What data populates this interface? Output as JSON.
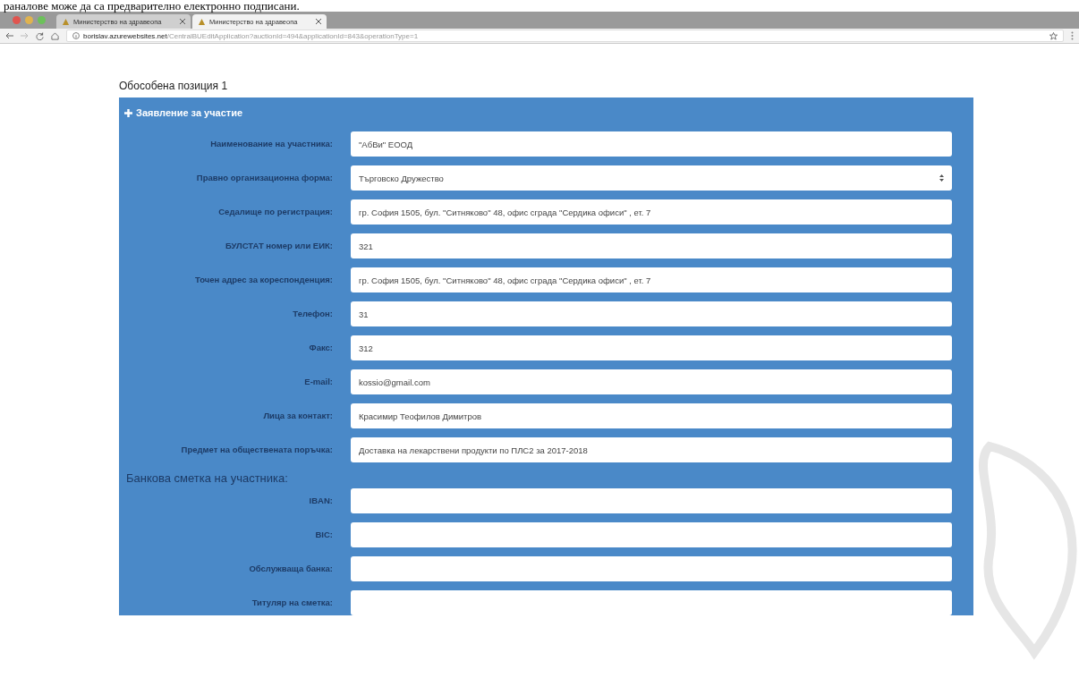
{
  "document_caption": "раналове може да са предварително електронно подписани.",
  "browser": {
    "tabs": [
      {
        "title": "Министерство на здравеопа",
        "selected": false
      },
      {
        "title": "Министерство на здравеопа",
        "selected": true
      }
    ],
    "url_domain": "borislav.azurewebsites.net",
    "url_path": "/CentralBUEditApplication?auctionId=494&applicationId=843&operationType=1"
  },
  "page": {
    "heading": "Обособена позиция 1",
    "panel": {
      "title": "Заявление за участие",
      "fields": [
        {
          "kind": "input",
          "label": "Наименование на участника:",
          "value": "\"АбВи\" ЕООД"
        },
        {
          "kind": "select",
          "label": "Правно организационна форма:",
          "value": "Търговско Дружество"
        },
        {
          "kind": "input",
          "label": "Седалище по регистрация:",
          "value": "гр. София 1505, бул. \"Ситняково\"  48, офис сграда \"Сердика офиси\" , ет. 7"
        },
        {
          "kind": "input",
          "label": "БУЛСТАТ номер или ЕИК:",
          "value": "321"
        },
        {
          "kind": "input",
          "label": "Точен адрес за кореспонденция:",
          "value": "гр. София 1505, бул. \"Ситняково\"  48, офис сграда \"Сердика офиси\" , ет. 7"
        },
        {
          "kind": "input",
          "label": "Телефон:",
          "value": "31"
        },
        {
          "kind": "input",
          "label": "Факс:",
          "value": "312"
        },
        {
          "kind": "input",
          "label": "E-mail:",
          "value": "kossio@gmail.com"
        },
        {
          "kind": "input",
          "label": "Лица за контакт:",
          "value": "Красимир Теофилов Димитров"
        },
        {
          "kind": "input",
          "label": "Предмет на обществената поръчка:",
          "value": "Доставка на лекарствени продукти по ПЛС2 за 2017-2018"
        }
      ],
      "bank_heading": "Банкова сметка на участника:",
      "bank_fields": [
        {
          "kind": "input",
          "label": "IBAN:"
        },
        {
          "kind": "input",
          "label": "BIC:"
        },
        {
          "kind": "input",
          "label": "Обслужваща банка:"
        },
        {
          "kind": "input",
          "label": "Титуляр на сметка:"
        }
      ]
    }
  }
}
